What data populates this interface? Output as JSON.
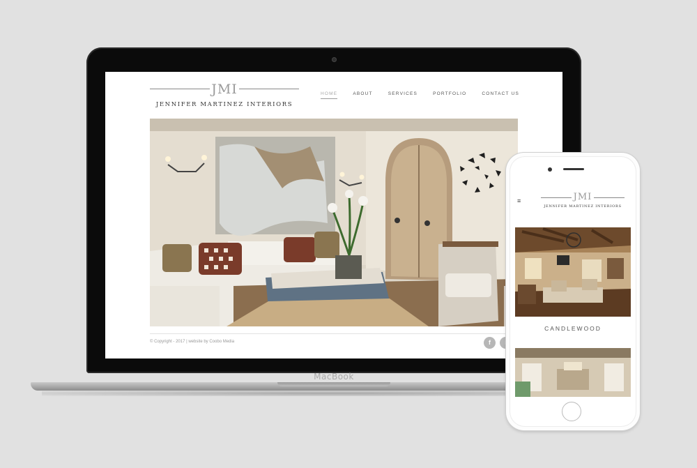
{
  "device_laptop_label": "MacBook",
  "site": {
    "logo_monogram": "JMI",
    "logo_name": "Jennifer Martinez Interiors",
    "nav": [
      "HOME",
      "ABOUT",
      "SERVICES",
      "PORTFOLIO",
      "CONTACT US"
    ],
    "active_nav": "HOME",
    "copyright": "© Copyright - 2017 | website by Coobo Media",
    "social": [
      "f",
      "i"
    ]
  },
  "mobile": {
    "menu_icon": "≡",
    "project_title": "CANDLEWOOD"
  },
  "colors": {
    "background": "#e1e1e1",
    "laptop_bezel": "#0b0b0b",
    "nav_text": "#555555",
    "nav_active": "#aaaaaa"
  }
}
